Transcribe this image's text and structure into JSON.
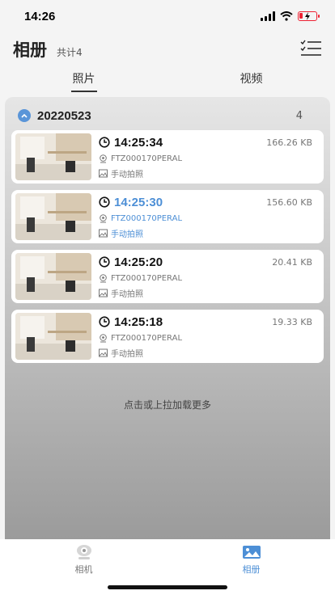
{
  "status_bar": {
    "time": "14:26"
  },
  "header": {
    "title": "相册",
    "count": "共计4"
  },
  "tabs": [
    {
      "label": "照片",
      "active": true
    },
    {
      "label": "视频",
      "active": false
    }
  ],
  "group": {
    "date": "20220523",
    "count": "4"
  },
  "items": [
    {
      "time": "14:25:34",
      "size": "166.26 KB",
      "device": "FTZ000170PERAL",
      "type": "手动拍照",
      "selected": false
    },
    {
      "time": "14:25:30",
      "size": "156.60 KB",
      "device": "FTZ000170PERAL",
      "type": "手动拍照",
      "selected": true
    },
    {
      "time": "14:25:20",
      "size": "20.41 KB",
      "device": "FTZ000170PERAL",
      "type": "手动拍照",
      "selected": false
    },
    {
      "time": "14:25:18",
      "size": "19.33 KB",
      "device": "FTZ000170PERAL",
      "type": "手动拍照",
      "selected": false
    }
  ],
  "load_more": "点击或上拉加载更多",
  "bottom_nav": [
    {
      "label": "相机",
      "icon": "camera-icon",
      "active": false
    },
    {
      "label": "相册",
      "icon": "gallery-icon",
      "active": true
    }
  ],
  "colors": {
    "accent": "#4d8fd6",
    "text": "#111111",
    "muted": "#777777"
  }
}
